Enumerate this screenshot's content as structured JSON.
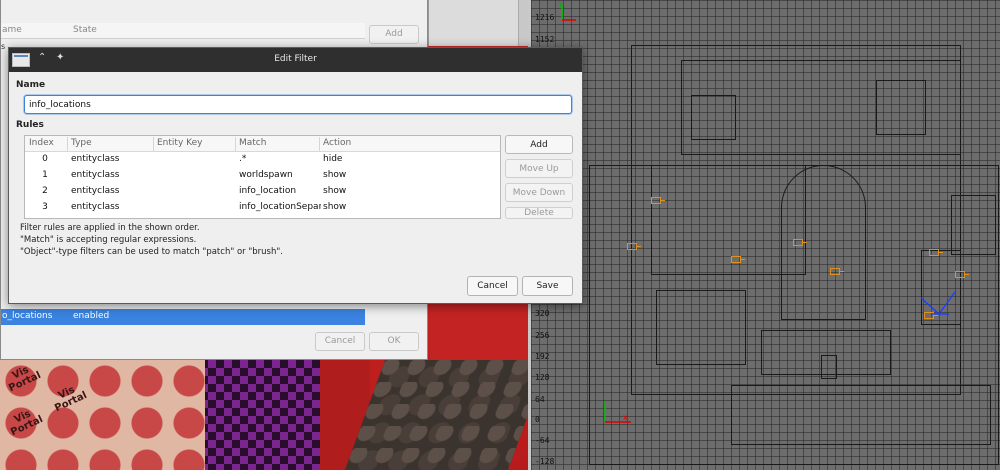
{
  "edit_dialog": {
    "title": "Edit Filter",
    "name_label": "Name",
    "name_value": "info_locations",
    "rules_label": "Rules",
    "columns": [
      "Index",
      "Type",
      "Entity Key",
      "Match",
      "Action"
    ],
    "rows": [
      {
        "index": "0",
        "type": "entityclass",
        "key": "",
        "match": ".*",
        "action": "hide"
      },
      {
        "index": "1",
        "type": "entityclass",
        "key": "",
        "match": "worldspawn",
        "action": "show"
      },
      {
        "index": "2",
        "type": "entityclass",
        "key": "",
        "match": "info_location",
        "action": "show"
      },
      {
        "index": "3",
        "type": "entityclass",
        "key": "",
        "match": "info_locationSeparat",
        "action": "show"
      }
    ],
    "buttons": {
      "add": "Add",
      "move_up": "Move Up",
      "move_down": "Move Down",
      "delete": "Delete"
    },
    "info": [
      "Filter rules are applied in the shown order.",
      "\"Match\" is accepting regular expressions.",
      "\"Object\"-type filters can be used to match \"patch\" or \"brush\"."
    ],
    "cancel_label": "Cancel",
    "save_label": "Save"
  },
  "back_dialog": {
    "columns": [
      "ame",
      "State"
    ],
    "add_label": "Add",
    "left_list_fragments": [
      "s",
      "",
      "",
      "",
      "",
      "",
      "",
      "",
      "",
      "",
      "",
      "",
      "",
      "",
      "",
      "",
      ""
    ],
    "selected_row": {
      "name": "o_locations",
      "state": "enabled"
    },
    "cancel_label": "Cancel",
    "ok_label": "OK"
  },
  "ortho_view": {
    "y_ticks": [
      "1216",
      "1152",
      "320",
      "256",
      "192",
      "128",
      "64",
      "0",
      "-64",
      "-128"
    ],
    "axis_label_y": "Y",
    "axis_label_x": "x"
  },
  "viewport_3d": {
    "portal_text": [
      "Vis\nPortal",
      "Vis\nPortal",
      "Vis\nPortal"
    ]
  },
  "colors": {
    "selection": "#3a83e0",
    "titlebar": "#2f2f2f",
    "entity_marker": "#e09020",
    "wall_red": "#cf2222"
  }
}
